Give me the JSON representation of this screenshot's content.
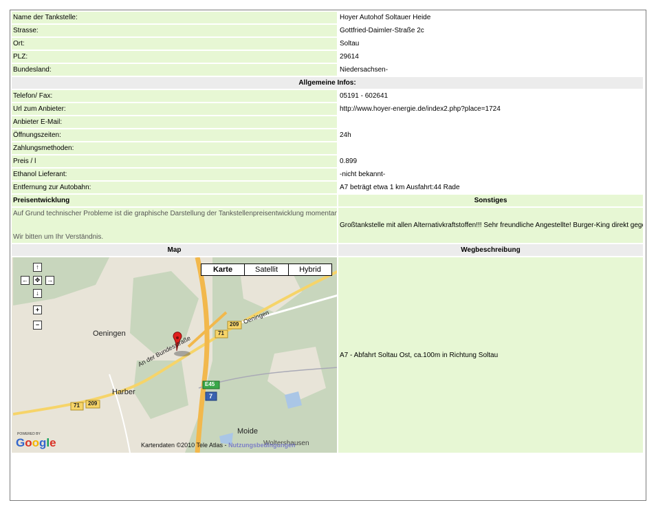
{
  "fields": [
    {
      "label": "Name der Tankstelle:",
      "value": "Hoyer Autohof Soltauer Heide"
    },
    {
      "label": "Strasse:",
      "value": "Gottfried-Daimler-Straße 2c"
    },
    {
      "label": "Ort:",
      "value": "Soltau"
    },
    {
      "label": "PLZ:",
      "value": "29614"
    },
    {
      "label": "Bundesland:",
      "value": "Niedersachsen-"
    }
  ],
  "section_title": "Allgemeine Infos:",
  "infos": [
    {
      "label": "Telefon/ Fax:",
      "value": "05191 - 602641"
    },
    {
      "label": "Url zum Anbieter:",
      "value": "http://www.hoyer-energie.de/index2.php?place=1724"
    },
    {
      "label": "Anbieter E-Mail:",
      "value": ""
    },
    {
      "label": "Öffnungszeiten:",
      "value": "24h"
    },
    {
      "label": "Zahlungsmethoden:",
      "value": ""
    },
    {
      "label": "Preis / l",
      "value": "0.899"
    },
    {
      "label": "Ethanol Lieferant:",
      "value": "-nicht bekannt-"
    },
    {
      "label": "Entfernung zur Autobahn:",
      "value": "A7 beträgt etwa 1 km Ausfahrt:44 Rade"
    }
  ],
  "preis": {
    "title": "Preisentwicklung",
    "note1": "Auf Grund technischer Probleme ist die graphische Darstellung der Tankstellenpreisentwicklung momentan nicht verfügbar.",
    "note2": "Wir bitten um Ihr Verständnis."
  },
  "sonstiges": {
    "title": "Sonstiges",
    "text": "Großtankstelle mit allen Alternativkraftstoffen!!! Sehr freundliche Angestellte! Burger-King direkt gegenüber! Koordinaten stimmen! (geprüft von Rosthasser)"
  },
  "map": {
    "title": "Map",
    "types": [
      "Karte",
      "Satellit",
      "Hybrid"
    ],
    "labels": {
      "oeningen_town": "Oeningen",
      "oeningen_road": "Oeningen",
      "harber": "Harber",
      "moide": "Moide",
      "wolterdingen": "Woltershausen",
      "bundesstrasse": "An der Bundesstraße",
      "b71_a": "71",
      "b71_b": "71",
      "b209_a": "209",
      "b209_b": "209",
      "e45": "E45",
      "a7": "7"
    },
    "nav": {
      "up": "↑",
      "left": "←",
      "center": "✥",
      "right": "→",
      "down": "↓",
      "zoom_in": "+",
      "zoom_out": "−"
    },
    "powered_by": "POWERED BY",
    "google": "Google",
    "copyright": "Kartendaten ©2010 Tele Atlas - ",
    "terms": "Nutzungsbedingungen"
  },
  "weg": {
    "title": "Wegbeschreibung",
    "text": "A7 - Abfahrt Soltau Ost, ca.100m in Richtung Soltau"
  }
}
